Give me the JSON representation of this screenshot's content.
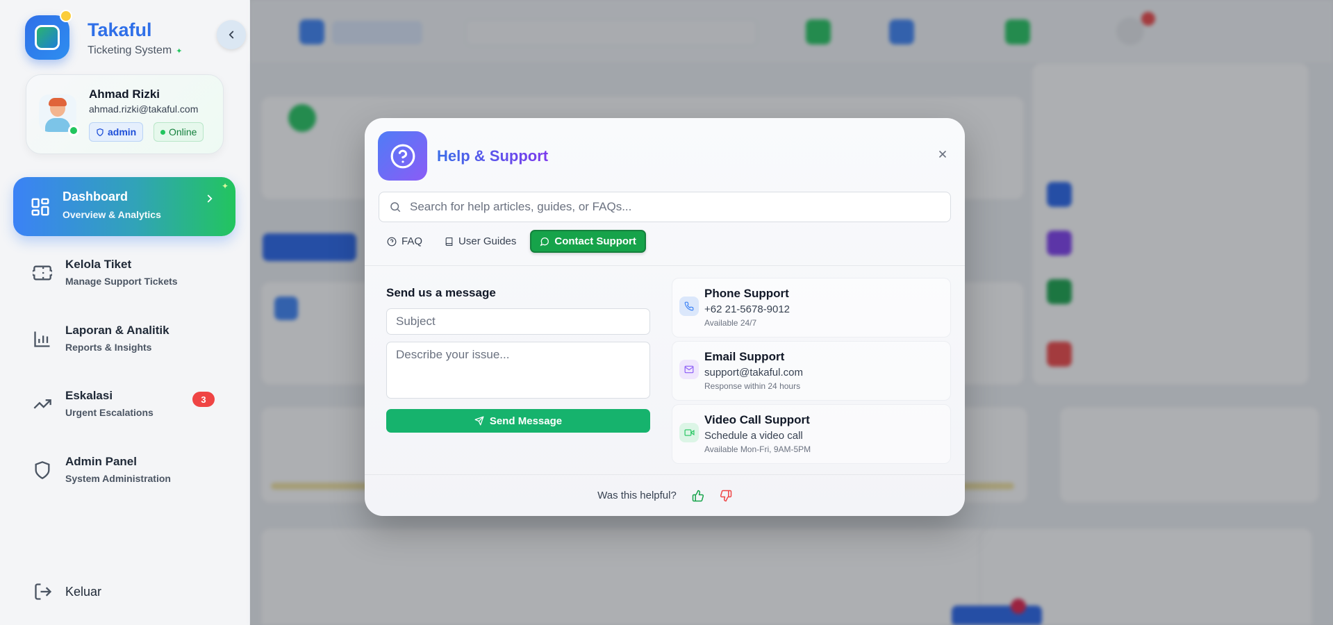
{
  "app": {
    "name": "Takaful",
    "subtitle": "Ticketing System"
  },
  "user": {
    "name": "Ahmad Rizki",
    "email": "ahmad.rizki@takaful.com",
    "role": "admin",
    "status": "Online"
  },
  "sidebar": {
    "active": {
      "label": "Dashboard",
      "sublabel": "Overview & Analytics"
    },
    "items": [
      {
        "label": "Kelola Tiket",
        "sublabel": "Manage Support Tickets",
        "icon": "ticket-icon"
      },
      {
        "label": "Laporan & Analitik",
        "sublabel": "Reports & Insights",
        "icon": "bar-chart-icon"
      },
      {
        "label": "Eskalasi",
        "sublabel": "Urgent Escalations",
        "icon": "trending-up-icon",
        "count": "3"
      },
      {
        "label": "Admin Panel",
        "sublabel": "System Administration",
        "icon": "shield-icon"
      }
    ],
    "logout": "Keluar"
  },
  "modal": {
    "title": "Help & Support",
    "search_placeholder": "Search for help articles, guides, or FAQs...",
    "tabs": {
      "faq": "FAQ",
      "guides": "User Guides",
      "contact": "Contact Support"
    },
    "form": {
      "heading": "Send us a message",
      "subject_placeholder": "Subject",
      "message_placeholder": "Describe your issue...",
      "send_label": "Send Message"
    },
    "options": [
      {
        "title": "Phone Support",
        "value": "+62 21-5678-9012",
        "note": "Available 24/7",
        "icon": "phone-icon"
      },
      {
        "title": "Email Support",
        "value": "support@takaful.com",
        "note": "Response within 24 hours",
        "icon": "mail-icon"
      },
      {
        "title": "Video Call Support",
        "value": "Schedule a video call",
        "note": "Available Mon-Fri, 9AM-5PM",
        "icon": "video-icon"
      }
    ],
    "feedback": "Was this helpful?"
  },
  "colors": {
    "primary": "#2f6fe8",
    "success": "#16a34a",
    "danger": "#ef4444",
    "purple": "#7c3aed"
  }
}
